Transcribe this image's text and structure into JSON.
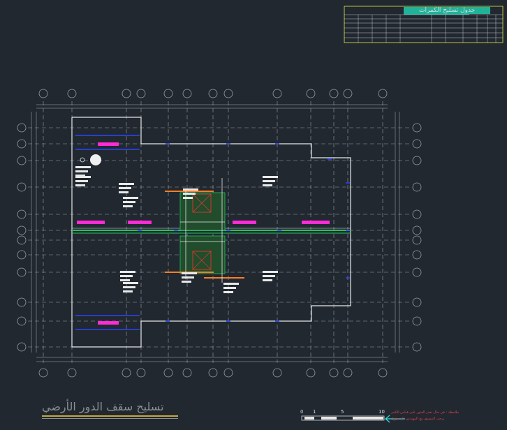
{
  "drawing": {
    "title": "تسليح سقف الدور الأرضي",
    "table_title": "جدول تسليح الكمرات",
    "notes": [
      "ملاحظة : في حال تعذر العثور على قياس للكمر",
      "يرجى التنسيق مع المهندس المسؤول"
    ],
    "scale_labels": [
      "0",
      "1",
      "5",
      "10"
    ],
    "colors": {
      "background": "#212830",
      "grid": "#c0c0c0",
      "walls": "#e8e8e8",
      "magenta": "#ff2bd6",
      "green": "#22c55e",
      "orange": "#ff7f27",
      "cyan": "#2de0e0",
      "blue": "#2b46ff",
      "yellow": "#e8e84a"
    }
  }
}
